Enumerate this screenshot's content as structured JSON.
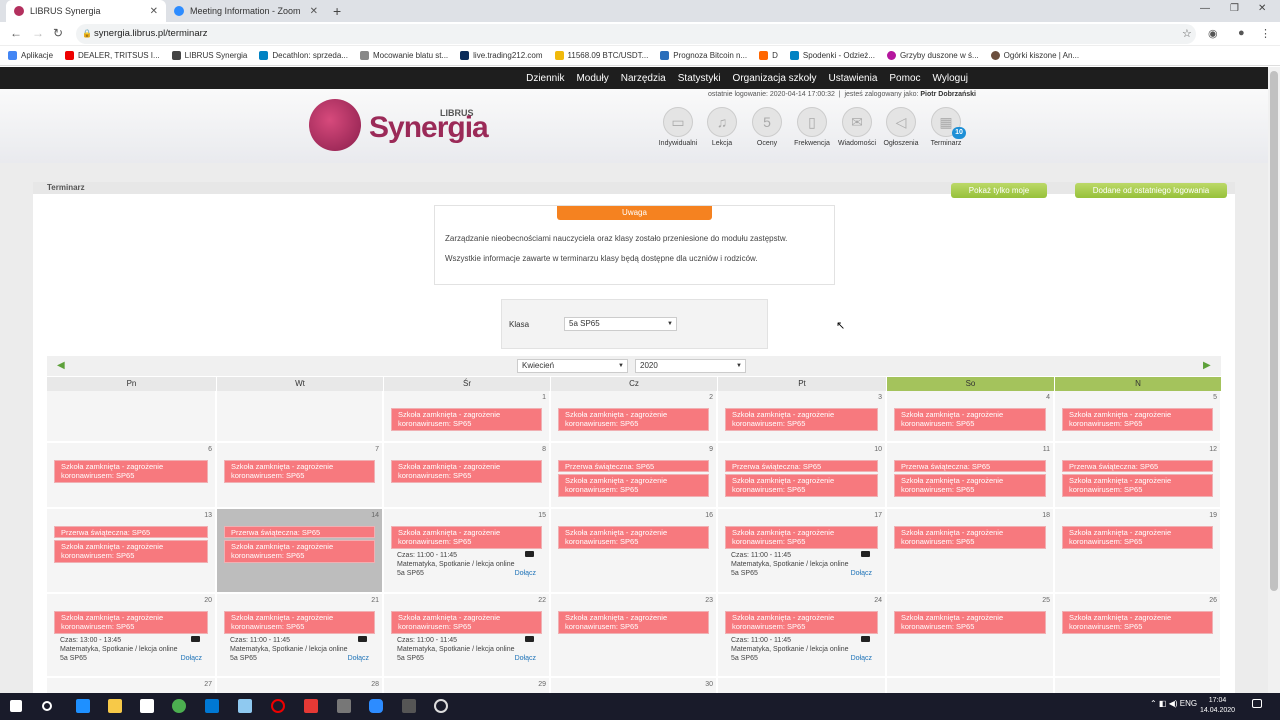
{
  "browser": {
    "tabs": [
      {
        "title": "LIBRUS Synergia",
        "icon": "synergia-favicon"
      },
      {
        "title": "Meeting Information - Zoom",
        "icon": "zoom-favicon"
      }
    ],
    "url": "synergia.librus.pl/terminarz",
    "bookmarks": [
      "Aplikacje",
      "DEALER, TRITSUS I...",
      "LIBRUS Synergia",
      "Decathlon: sprzeda...",
      "Mocowanie blatu st...",
      "live.trading212.com",
      "11568.09 BTC/USDT...",
      "Prognoza Bitcoin n...",
      "D",
      "Spodenki - Odzież...",
      "Grzyby duszone w ś...",
      "Ogórki kiszone | An..."
    ]
  },
  "menu": [
    "Dziennik",
    "Moduły",
    "Narzędzia",
    "Statystyki",
    "Organizacja szkoły",
    "Ustawienia",
    "Pomoc",
    "Wyloguj"
  ],
  "header": {
    "logo_small": "LIBRUS",
    "logo_text": "Synergia",
    "last_login": "ostatnie logowanie: 2020-04-14 17:00:32",
    "logged_as": "jesteś zalogowany jako:",
    "user": "Piotr Dobrzański",
    "icons": [
      {
        "label": "Indywidualni",
        "icon": "chat-icon"
      },
      {
        "label": "Lekcja",
        "icon": "bell-icon"
      },
      {
        "label": "Oceny",
        "icon": "grade-icon"
      },
      {
        "label": "Frekwencja",
        "icon": "clipboard-icon"
      },
      {
        "label": "Wiadomości",
        "icon": "mail-icon"
      },
      {
        "label": "Ogłoszenia",
        "icon": "megaphone-icon"
      },
      {
        "label": "Terminarz",
        "icon": "calendar-icon",
        "badge": "10"
      }
    ]
  },
  "breadcrumb": "Terminarz",
  "buttons": {
    "show_mine": "Pokaż tylko moje",
    "added_since": "Dodane od ostatniego logowania"
  },
  "alert": {
    "title": "Uwaga",
    "line1": "Zarządzanie nieobecnościami nauczyciela oraz klasy zostało przeniesione do modułu zastępstw.",
    "line2": "Wszystkie informacje zawarte w terminarzu klasy będą dostępne dla uczniów i rodziców."
  },
  "klasa": {
    "label": "Klasa",
    "value": "5a SP65"
  },
  "calendar": {
    "month": "Kwiecień",
    "year": "2020",
    "days": [
      "Pn",
      "Wt",
      "Śr",
      "Cz",
      "Pt",
      "So",
      "N"
    ],
    "closed": "Szkoła zamknięta - zagrożenie koronawirusem: SP65",
    "break": "Przerwa świąteczna: SP65",
    "join": "Dołącz",
    "meeting_a": "Czas: 11:00 - 11:45",
    "meeting_b": "Czas: 13:00 - 13:45",
    "meeting_desc": "Matematyka, Spotkanie / lekcja online",
    "meeting_class": "5a SP65",
    "weeks": [
      [
        "",
        "",
        "1",
        "2",
        "3",
        "4",
        "5"
      ],
      [
        "6",
        "7",
        "8",
        "9",
        "10",
        "11",
        "12"
      ],
      [
        "13",
        "14",
        "15",
        "16",
        "17",
        "18",
        "19"
      ],
      [
        "20",
        "21",
        "22",
        "23",
        "24",
        "25",
        "26"
      ],
      [
        "27",
        "28",
        "29",
        "30",
        "",
        "",
        ""
      ]
    ]
  },
  "taskbar": {
    "time": "17:04",
    "date": "14.04.2020"
  }
}
